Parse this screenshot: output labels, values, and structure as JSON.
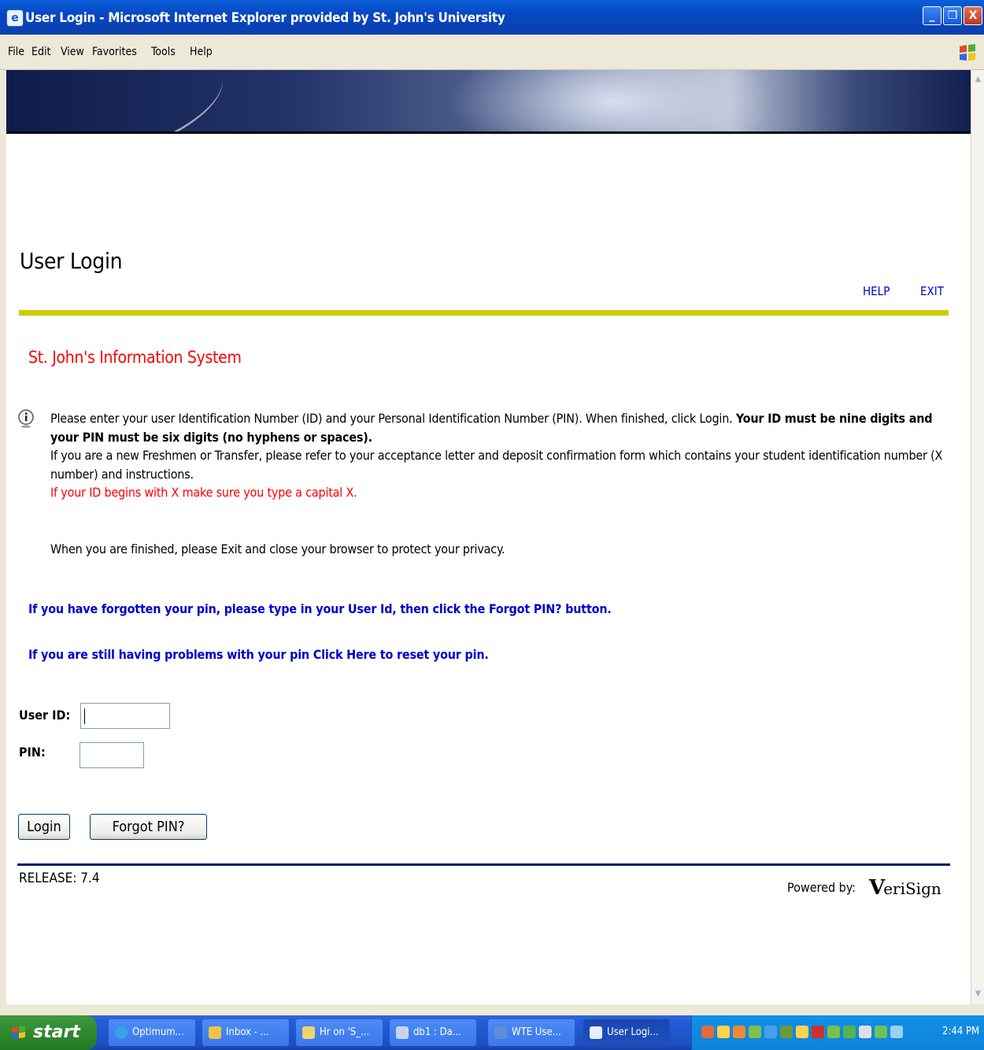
{
  "window": {
    "title": "User Login - Microsoft Internet Explorer provided by St. John's University",
    "minimize_label": "_",
    "maximize_label": "❐",
    "close_label": "X"
  },
  "menu": {
    "items": [
      "File",
      "Edit",
      "View",
      "Favorites",
      "Tools",
      "Help"
    ]
  },
  "page": {
    "help_link": "HELP",
    "exit_link": "EXIT",
    "title": "User Login",
    "system_name": "St. John's Information System",
    "info_text_1": "Please enter your user Identification Number (ID) and your Personal Identification Number (PIN). When finished, click Login.",
    "info_bold": "Your ID must be nine digits and your PIN must be six digits (no hyphens or spaces).",
    "info_text_2": "If you are a new Freshmen or Transfer, please refer to your acceptance letter and deposit confirmation form which contains your student identification number (X number) and instructions.",
    "info_red": "If your ID begins with X make sure you type a capital X.",
    "finish_text": "When you are finished, please Exit and close your browser to protect your privacy.",
    "forgot_msg": "If you have forgotten your pin, please type in your User Id, then click the Forgot PIN? button.",
    "problems_msg": "If you are still having problems with your pin Click Here to reset your pin.",
    "user_id_label": "User ID:",
    "user_id_value": "",
    "pin_label": "PIN:",
    "pin_value": "",
    "login_button": "Login",
    "forgot_button": "Forgot PIN?",
    "release": "RELEASE: 7.4",
    "powered_by": "Powered by:",
    "verisign_check": "V",
    "verisign_text": "eriSign"
  },
  "taskbar": {
    "start_label": "start",
    "tasks": [
      {
        "label": "Optimum..."
      },
      {
        "label": "Inbox - ..."
      },
      {
        "label": "Hr on 'S_..."
      },
      {
        "label": "db1 : Da..."
      },
      {
        "label": "WTE Use..."
      },
      {
        "label": "User Logi..."
      }
    ],
    "clock": "2:44 PM"
  },
  "colors": {
    "accent_yellow": "#cccc00",
    "link_blue": "#0000cc",
    "alert_red": "#ff0000",
    "rule_navy": "#001a66"
  }
}
